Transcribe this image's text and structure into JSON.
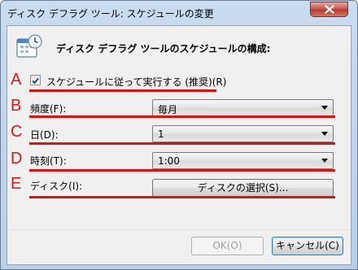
{
  "window": {
    "title": "ディスク デフラグ ツール: スケジュールの変更"
  },
  "header": {
    "title": "ディスク デフラグ ツールのスケジュールの構成:"
  },
  "colors": {
    "annotation_red": "#e01010",
    "client_bg": "#f0f0f0"
  },
  "icons": {
    "header": "calendar-clock-icon",
    "close": "close-icon",
    "checkbox": "check-icon",
    "dropdown": "chevron-down-icon"
  },
  "annotations": {
    "a": "A",
    "b": "B",
    "c": "C",
    "d": "D",
    "e": "E"
  },
  "schedule": {
    "checkbox_label": "スケジュールに従って実行する (推奨)(R)",
    "checked": true,
    "frequency_label": "頻度(F):",
    "frequency_value": "毎月",
    "day_label": "日(D):",
    "day_value": "1",
    "time_label": "時刻(T):",
    "time_value": "1:00",
    "disk_label": "ディスク(I):",
    "disk_button": "ディスクの選択(S)..."
  },
  "footer": {
    "ok_label": "OK(O)",
    "cancel_label": "キャンセル(C)"
  }
}
